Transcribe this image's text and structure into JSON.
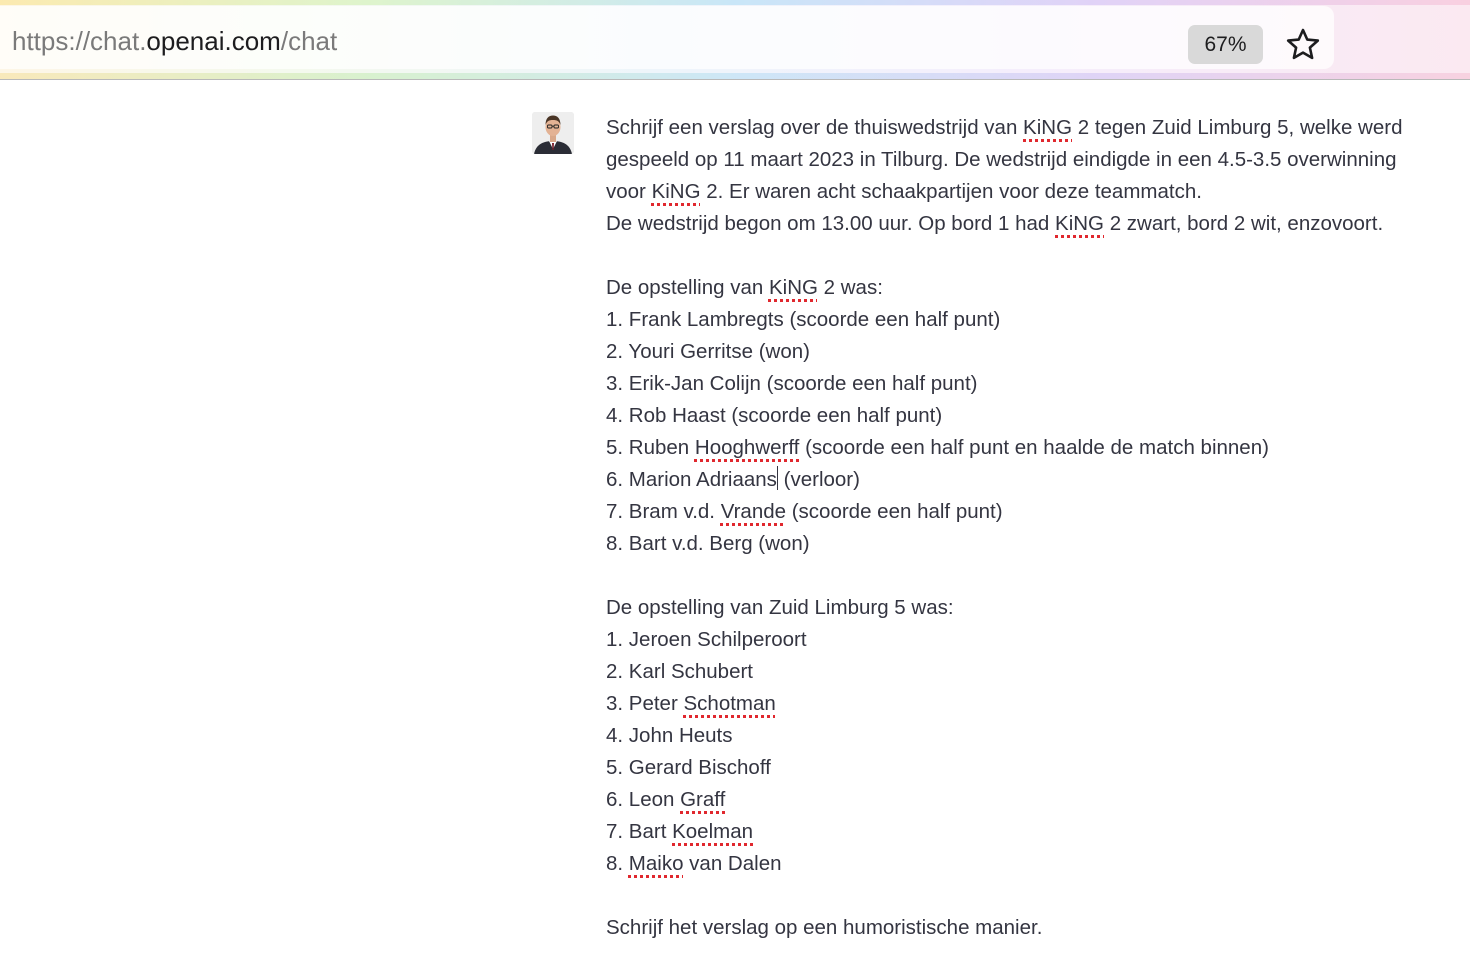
{
  "browser": {
    "url_scheme": "https://",
    "url_sub": "chat.",
    "url_host": "openai.com",
    "url_path": "/chat",
    "zoom_level": "67%",
    "bookmark_icon": "star-outline-icon"
  },
  "message": {
    "author_avatar": "user-avatar",
    "intro": {
      "l1a": "Schrijf een verslag over de thuiswedstrijd van ",
      "l1b": "KiNG",
      "l1c": " 2 tegen Zuid Limburg 5, welke werd",
      "l2": "gespeeld op 11 maart 2023 in Tilburg. De wedstrijd eindigde in een 4.5-3.5 overwinning",
      "l3a": "voor ",
      "l3b": "KiNG",
      "l3c": " 2. Er waren acht schaakpartijen voor deze teammatch.",
      "l4a": "De wedstrijd begon om 13.00 uur. Op bord 1 had ",
      "l4b": "KiNG",
      "l4c": " 2 zwart, bord 2 wit, enzovoort."
    },
    "king_lineup": {
      "heading_a": "De opstelling van ",
      "heading_b": "KiNG",
      "heading_c": " 2 was:",
      "p1": "1. Frank Lambregts (scoorde een half punt)",
      "p2": "2. Youri Gerritse (won)",
      "p3": "3. Erik-Jan Colijn (scoorde een half punt)",
      "p4": "4. Rob Haast (scoorde een half punt)",
      "p5a": "5. Ruben ",
      "p5b": "Hooghwerff",
      "p5c": " (scoorde een half punt en haalde de match binnen)",
      "p6a": "6. Marion Adriaans",
      "p6b": " (verloor)",
      "p7a": "7. Bram v.d. ",
      "p7b": "Vrande",
      "p7c": " (scoorde een half punt)",
      "p8": "8. Bart v.d. Berg (won)"
    },
    "zl_lineup": {
      "heading": "De opstelling van Zuid Limburg 5 was:",
      "p1": "1. Jeroen Schilperoort",
      "p2": "2. Karl Schubert",
      "p3a": "3. Peter ",
      "p3b": "Schotman",
      "p4": "4. John Heuts",
      "p5": "5. Gerard Bischoff",
      "p6a": "6. Leon ",
      "p6b": "Graff",
      "p7a": "7. Bart ",
      "p7b": "Koelman",
      "p8a": "8. ",
      "p8b": "Maiko",
      "p8c": " van Dalen"
    },
    "closing": "Schrijf het verslag op een humoristische manier."
  }
}
